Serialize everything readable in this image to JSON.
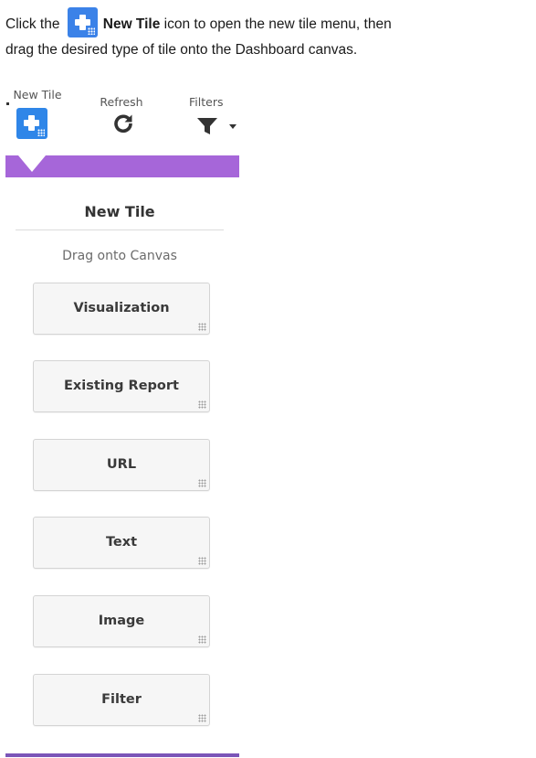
{
  "instruction": {
    "text_before": "Click the",
    "bold_label": "New Tile",
    "text_after_line1": " icon to open the new tile menu, then",
    "text_line2": "drag the desired type of tile onto the Dashboard canvas."
  },
  "toolbar": {
    "items": [
      {
        "label": "New Tile",
        "icon": "new-tile-icon"
      },
      {
        "label": "Refresh",
        "icon": "refresh-icon"
      },
      {
        "label": "Filters",
        "icon": "filter-icon"
      }
    ]
  },
  "panel": {
    "title": "New Tile",
    "subtitle": "Drag onto Canvas",
    "tiles": [
      {
        "label": "Visualization"
      },
      {
        "label": "Existing Report"
      },
      {
        "label": "URL"
      },
      {
        "label": "Text"
      },
      {
        "label": "Image"
      },
      {
        "label": "Filter"
      }
    ]
  },
  "colors": {
    "accent_blue": "#2f86e8",
    "band_purple": "#a666d9",
    "bottom_purple": "#7b55b8"
  }
}
